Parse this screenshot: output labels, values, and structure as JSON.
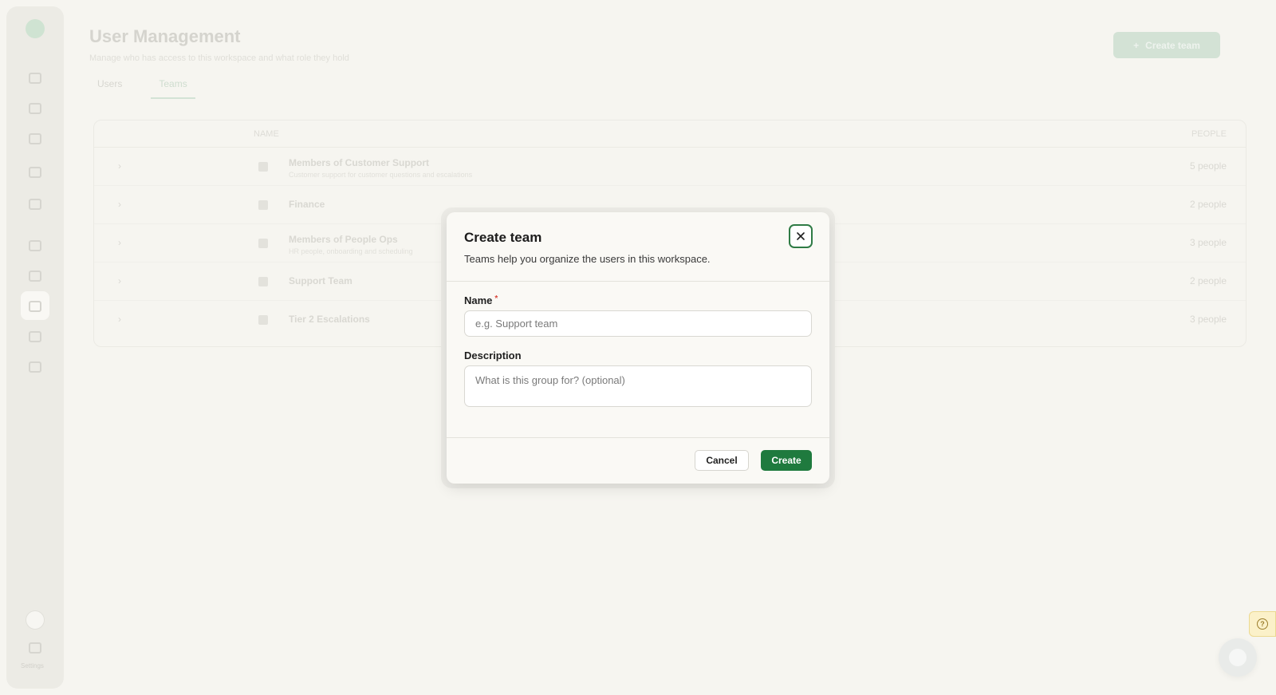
{
  "background": {
    "page_title": "User Management",
    "page_subtitle": "Manage who has access to this workspace and what role they hold",
    "tabs": [
      {
        "label": "Users"
      },
      {
        "label": "Teams"
      }
    ],
    "create_team_button": "Create team",
    "table": {
      "headers": {
        "name": "NAME",
        "people": "PEOPLE"
      },
      "rows": [
        {
          "name": "Members of Customer Support",
          "description": "Customer support for customer questions and escalations",
          "people": "5 people"
        },
        {
          "name": "Finance",
          "description": "",
          "people": "2 people"
        },
        {
          "name": "Members of People Ops",
          "description": "HR people, onboarding and scheduling",
          "people": "3 people"
        },
        {
          "name": "Support Team",
          "description": "",
          "people": "2 people"
        },
        {
          "name": "Tier 2 Escalations",
          "description": "",
          "people": "3 people"
        }
      ]
    },
    "sidebar_footer": "Settings"
  },
  "modal": {
    "title": "Create team",
    "subtitle": "Teams help you organize the users in this workspace.",
    "name_label": "Name",
    "required_mark": "*",
    "name_placeholder": "e.g. Support team",
    "name_value": "",
    "description_label": "Description",
    "description_placeholder": "What is this group for? (optional)",
    "description_value": "",
    "cancel_label": "Cancel",
    "create_label": "Create"
  },
  "colors": {
    "accent": "#1f7a3e",
    "required": "#d9463b",
    "help_badge": "#fbf1c9"
  },
  "icons": {
    "close": "close-icon",
    "help": "help-icon",
    "chat": "chat-icon"
  }
}
